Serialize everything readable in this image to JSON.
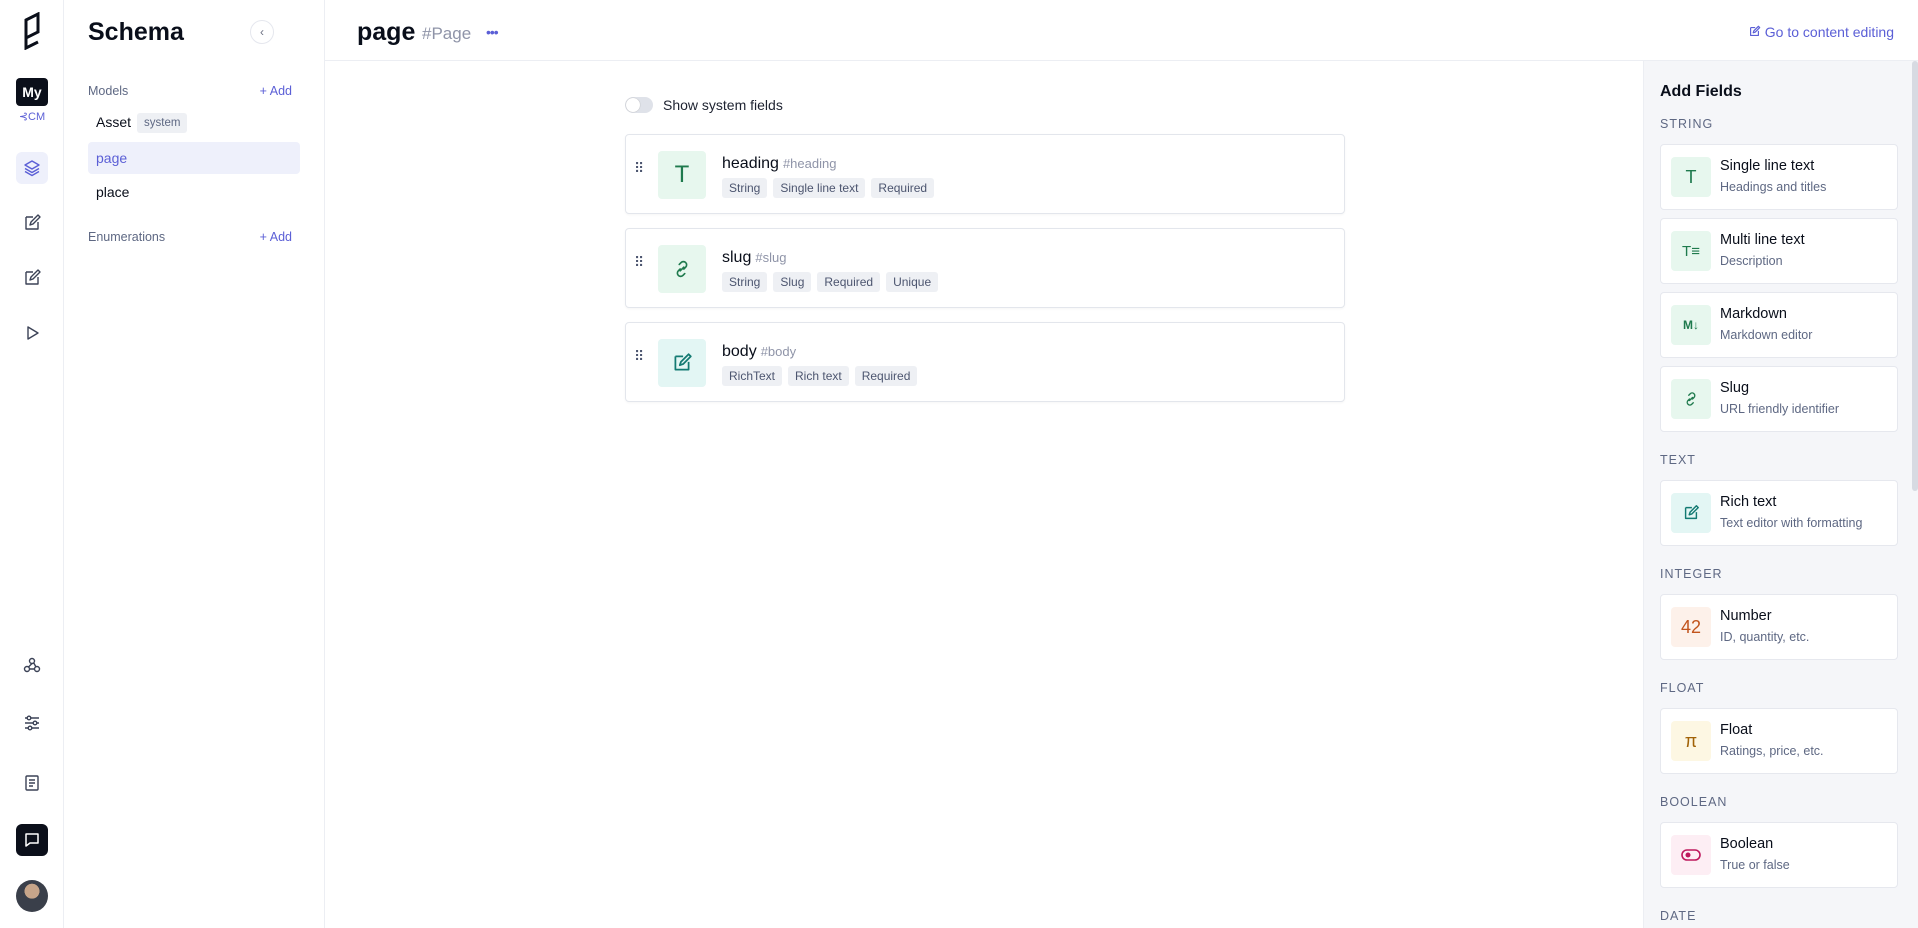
{
  "rail": {
    "project_label": "My",
    "project_sub": "⊰CM"
  },
  "schema": {
    "title": "Schema",
    "models_label": "Models",
    "add_label": "Add",
    "models": [
      {
        "name": "Asset",
        "badge": "system"
      },
      {
        "name": "page"
      },
      {
        "name": "place"
      }
    ],
    "enumerations_label": "Enumerations",
    "enum_add_label": "Add"
  },
  "header": {
    "title": "page",
    "api_id": "#Page",
    "more": "•••",
    "goto": "Go to content editing"
  },
  "main": {
    "toggle_label": "Show system fields",
    "fields": [
      {
        "name": "heading",
        "api_id": "#heading",
        "tags": [
          "String",
          "Single line text",
          "Required"
        ]
      },
      {
        "name": "slug",
        "api_id": "#slug",
        "tags": [
          "String",
          "Slug",
          "Required",
          "Unique"
        ]
      },
      {
        "name": "body",
        "api_id": "#body",
        "tags": [
          "RichText",
          "Rich text",
          "Required"
        ]
      }
    ]
  },
  "add_fields": {
    "title": "Add Fields",
    "categories": {
      "string": "STRING",
      "text": "TEXT",
      "integer": "INTEGER",
      "float": "FLOAT",
      "boolean": "BOOLEAN",
      "date": "DATE"
    },
    "cards": {
      "single_line": {
        "title": "Single line text",
        "desc": "Headings and titles",
        "icon": "T"
      },
      "multi_line": {
        "title": "Multi line text",
        "desc": "Description",
        "icon": "T≡"
      },
      "markdown": {
        "title": "Markdown",
        "desc": "Markdown editor",
        "icon": "M↓"
      },
      "slug": {
        "title": "Slug",
        "desc": "URL friendly identifier"
      },
      "rich_text": {
        "title": "Rich text",
        "desc": "Text editor with formatting"
      },
      "number": {
        "title": "Number",
        "desc": "ID, quantity, etc.",
        "icon": "42"
      },
      "float": {
        "title": "Float",
        "desc": "Ratings, price, etc.",
        "icon": "π"
      },
      "boolean": {
        "title": "Boolean",
        "desc": "True or false"
      }
    }
  },
  "colors": {
    "accent": "#5b5fd6",
    "string_icon_bg": "#e7f7ee",
    "string_icon_fg": "#1f7a4d",
    "text_icon_bg": "#e3f6f4",
    "text_icon_fg": "#137a72",
    "number_fg": "#c2541c",
    "float_fg": "#a16207",
    "boolean_fg": "#be185d"
  }
}
